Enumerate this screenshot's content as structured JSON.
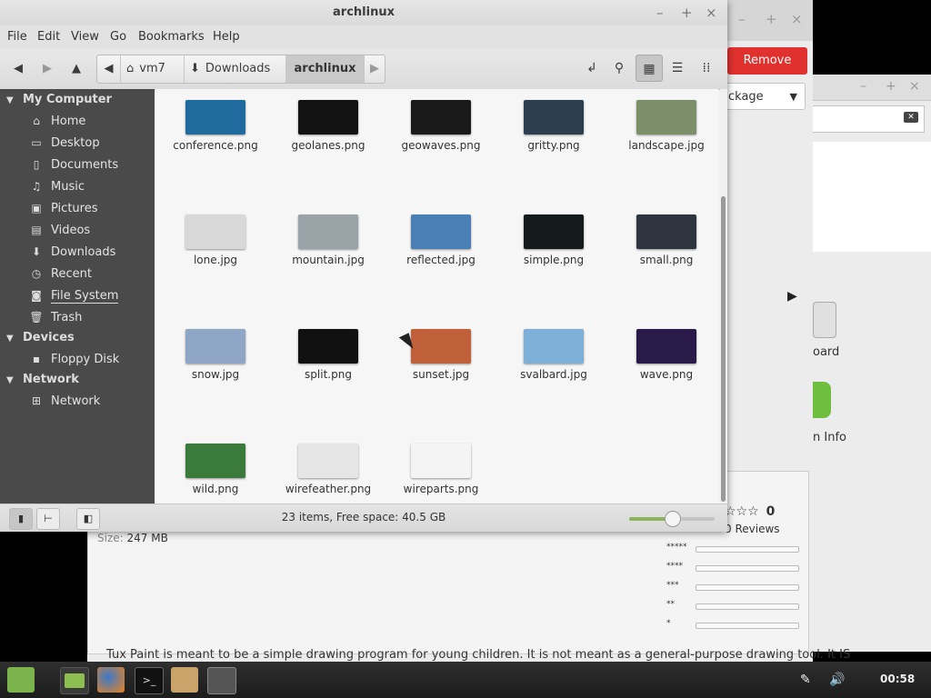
{
  "window": {
    "title": "archlinux",
    "controls": {
      "minimize": "–",
      "maximize": "+",
      "close": "×"
    }
  },
  "menu": [
    "File",
    "Edit",
    "View",
    "Go",
    "Bookmarks",
    "Help"
  ],
  "breadcrumbs": [
    {
      "label": "vm7",
      "icon": "home-icon"
    },
    {
      "label": "Downloads",
      "icon": "download-icon"
    },
    {
      "label": "archlinux",
      "icon": ""
    }
  ],
  "sidebar": {
    "sections": [
      {
        "title": "My Computer",
        "items": [
          {
            "label": "Home",
            "icon": "home-icon"
          },
          {
            "label": "Desktop",
            "icon": "desktop-icon"
          },
          {
            "label": "Documents",
            "icon": "documents-icon"
          },
          {
            "label": "Music",
            "icon": "music-icon"
          },
          {
            "label": "Pictures",
            "icon": "pictures-icon"
          },
          {
            "label": "Videos",
            "icon": "videos-icon"
          },
          {
            "label": "Downloads",
            "icon": "download-icon"
          },
          {
            "label": "Recent",
            "icon": "recent-icon"
          },
          {
            "label": "File System",
            "icon": "drive-icon"
          },
          {
            "label": "Trash",
            "icon": "trash-icon"
          }
        ]
      },
      {
        "title": "Devices",
        "items": [
          {
            "label": "Floppy Disk",
            "icon": "floppy-icon"
          }
        ]
      },
      {
        "title": "Network",
        "items": [
          {
            "label": "Network",
            "icon": "network-icon"
          }
        ]
      }
    ]
  },
  "files": [
    {
      "name": "conference.png",
      "color": "#1f6b9e"
    },
    {
      "name": "geolanes.png",
      "color": "#121212"
    },
    {
      "name": "geowaves.png",
      "color": "#1a1a1a"
    },
    {
      "name": "gritty.png",
      "color": "#2c3e50"
    },
    {
      "name": "landscape.jpg",
      "color": "#7a8f6a"
    },
    {
      "name": "lone.jpg",
      "color": "#d8d8d8"
    },
    {
      "name": "mountain.jpg",
      "color": "#9aa3a8"
    },
    {
      "name": "reflected.jpg",
      "color": "#4a7fb5"
    },
    {
      "name": "simple.png",
      "color": "#151a1d"
    },
    {
      "name": "small.png",
      "color": "#2e3440"
    },
    {
      "name": "snow.jpg",
      "color": "#8fa6c6"
    },
    {
      "name": "split.png",
      "color": "#111111"
    },
    {
      "name": "sunset.jpg",
      "color": "#c0603a"
    },
    {
      "name": "svalbard.jpg",
      "color": "#7fb1d8"
    },
    {
      "name": "wave.png",
      "color": "#2a1a4a"
    },
    {
      "name": "wild.png",
      "color": "#3a7a3a"
    },
    {
      "name": "wirefeather.png",
      "color": "#e6e6e6"
    },
    {
      "name": "wireparts.png",
      "color": "#f4f4f4"
    }
  ],
  "status": {
    "text": "23 items, Free space: 40.5 GB",
    "zoom_level": 0.5
  },
  "background_app": {
    "remove_label": "Remove",
    "dropdown_value": "ckage",
    "label_board": "oard",
    "label_info": "n Info",
    "rating_count": "0",
    "reviews_label": "0 Reviews",
    "size_label": "Size:",
    "size_value": "247 MB",
    "description": "Tux Paint is meant to be a simple drawing program for young children. It is not meant as a general-purpose drawing tool. It IS",
    "star_rows": [
      "*****",
      "****",
      "***",
      "**",
      "*"
    ]
  },
  "taskbar": {
    "clock": "00:58",
    "apps": [
      "mint-menu-icon",
      "files-icon",
      "firefox-icon",
      "terminal-icon",
      "package-icon",
      "mixer-icon"
    ]
  },
  "colors": {
    "accent_remove": "#e0312f",
    "sidebar_bg": "#4a4a4a",
    "zoom_fill": "#8ab55b"
  }
}
